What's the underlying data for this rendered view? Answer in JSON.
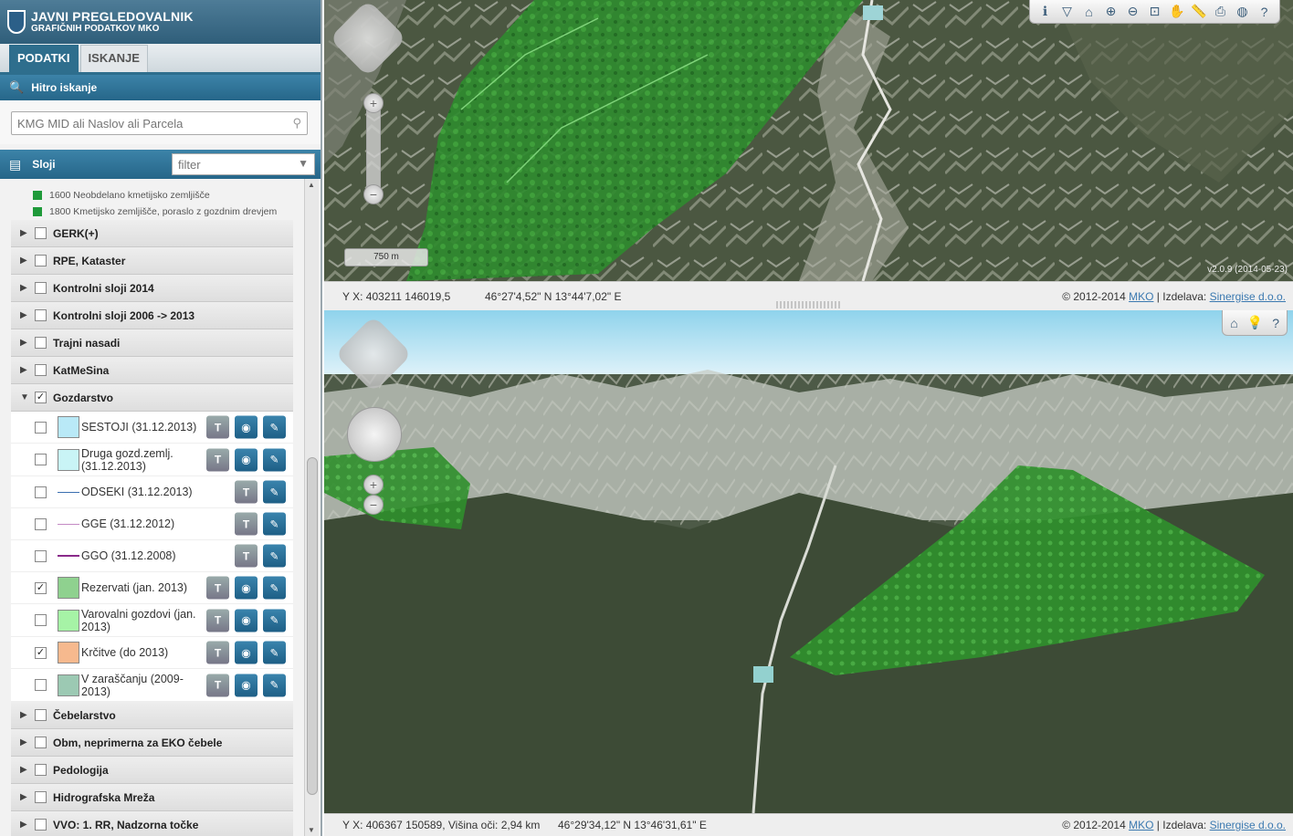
{
  "app": {
    "title_line1": "JAVNI PREGLEDOVALNIK",
    "title_line2": "GRAFIČNIH PODATKOV MKO"
  },
  "tabs": [
    {
      "label": "PODATKI",
      "active": true
    },
    {
      "label": "ISKANJE",
      "active": false
    }
  ],
  "quick_search": {
    "title": "Hitro iskanje",
    "placeholder": "KMG MID ali Naslov ali Parcela"
  },
  "layers": {
    "title": "Sloji",
    "filter_placeholder": "filter"
  },
  "legend_items": [
    {
      "label": "1600 Neobdelano kmetijsko zemljišče"
    },
    {
      "label": "1800 Kmetijsko zemljišče, poraslo z gozdnim drevjem"
    }
  ],
  "groups_before": [
    {
      "label": "GERK(+)",
      "checked": false
    },
    {
      "label": "RPE, Kataster",
      "checked": false
    },
    {
      "label": "Kontrolni sloji 2014",
      "checked": false
    },
    {
      "label": "Kontrolni sloji 2006 -> 2013",
      "checked": false
    },
    {
      "label": "Trajni nasadi",
      "checked": false
    },
    {
      "label": "KatMeSina",
      "checked": false
    }
  ],
  "open_group": {
    "label": "Gozdarstvo",
    "checked": true,
    "items": [
      {
        "label": "SESTOJI (31.12.2013)",
        "checked": false,
        "symbol": "box",
        "color": "#b9e9f7"
      },
      {
        "label": "Druga gozd.zemlj. (31.12.2013)",
        "checked": false,
        "symbol": "box",
        "color": "#c9f4f6"
      },
      {
        "label": "ODSEKI (31.12.2013)",
        "checked": false,
        "symbol": "line",
        "color": "#3a6fb0"
      },
      {
        "label": "GGE (31.12.2012)",
        "checked": false,
        "symbol": "line",
        "color": "#c48ac4"
      },
      {
        "label": "GGO (31.12.2008)",
        "checked": false,
        "symbol": "line",
        "color": "#8a2a8a"
      },
      {
        "label": "Rezervati (jan. 2013)",
        "checked": true,
        "symbol": "box",
        "color": "#8fd18f"
      },
      {
        "label": "Varovalni gozdovi (jan. 2013)",
        "checked": false,
        "symbol": "box",
        "color": "#a6f3a6"
      },
      {
        "label": "Krčitve (do 2013)",
        "checked": true,
        "symbol": "box",
        "color": "#f6b98e"
      },
      {
        "label": "V zaraščanju (2009-2013)",
        "checked": false,
        "symbol": "box",
        "color": "#9cc9b3"
      }
    ]
  },
  "groups_after": [
    {
      "label": "Čebelarstvo",
      "checked": false
    },
    {
      "label": "Obm, neprimerna za EKO čebele",
      "checked": false
    },
    {
      "label": "Pedologija",
      "checked": false
    },
    {
      "label": "Hidrografska Mreža",
      "checked": false
    },
    {
      "label": "VVO: 1. RR, Nadzorna točke",
      "checked": false
    }
  ],
  "map2d": {
    "scale": "750 m",
    "version": "v2.0.9 (2014-05-23)",
    "coord_xy": "Y X: 403211 146019,5",
    "coord_ll": "46°27'4,52\" N 13°44'7,02\" E",
    "toolbar_icons": [
      "info-icon",
      "select-icon",
      "home-icon",
      "zoom-in-icon",
      "zoom-out-icon",
      "zoom-box-icon",
      "pan-icon",
      "measure-icon",
      "print-icon",
      "globe-icon",
      "help-icon"
    ]
  },
  "map3d": {
    "coord_xy": "Y X: 406367 150589, Višina oči: 2,94 km",
    "coord_ll": "46°29'34,12\" N 13°46'31,61\" E",
    "toolbar_icons": [
      "home-icon",
      "bulb-icon",
      "help-icon"
    ]
  },
  "copyright": {
    "prefix": "© 2012-2014",
    "org": "MKO",
    "sep": "| Izdelava:",
    "maker": "Sinergise d.o.o."
  }
}
